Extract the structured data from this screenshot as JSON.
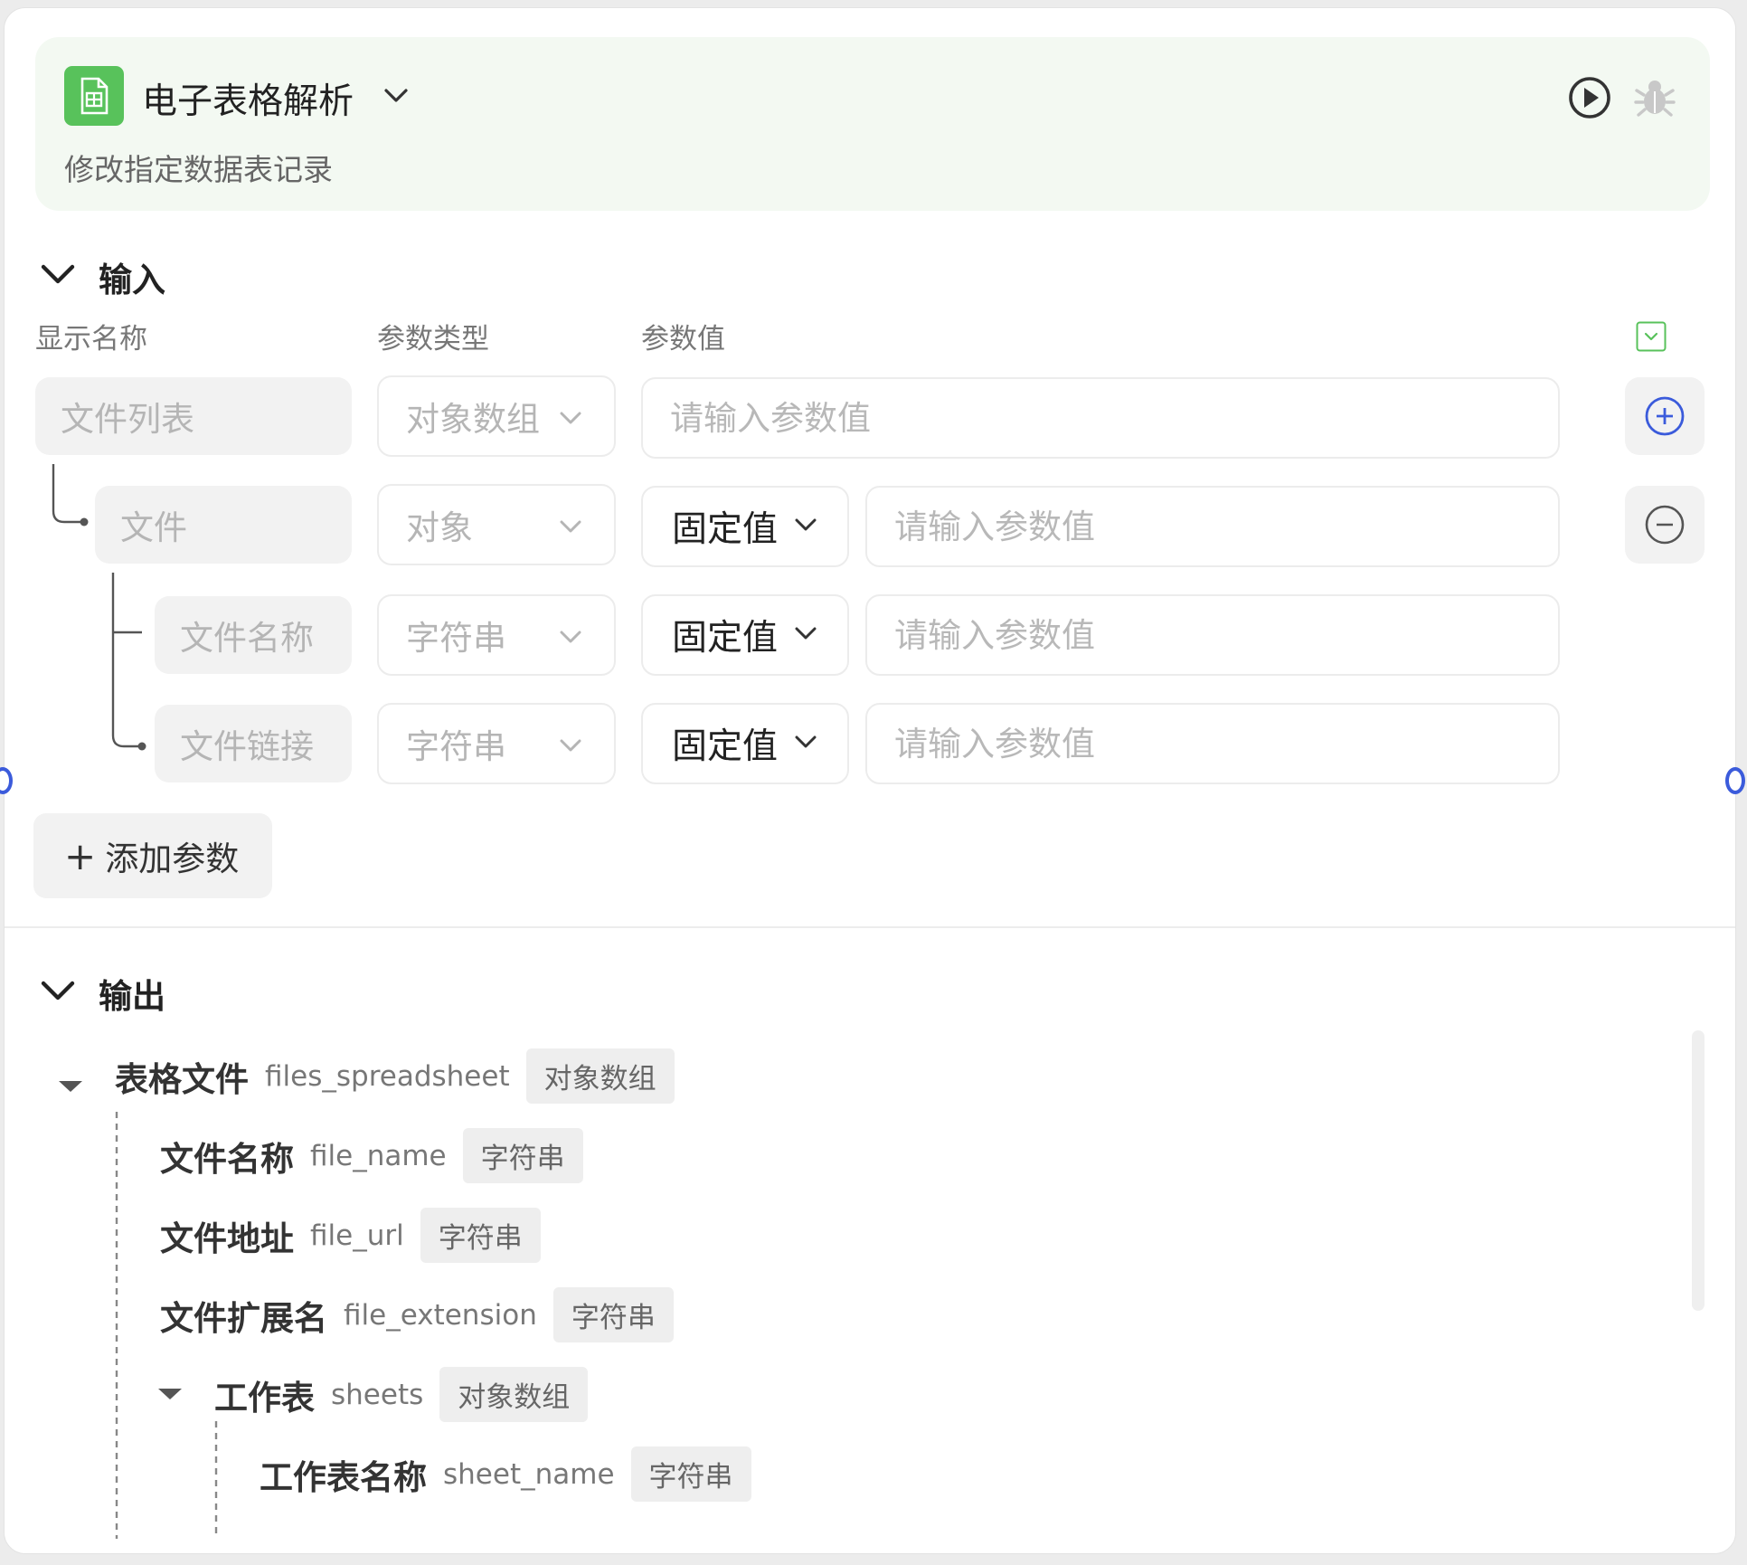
{
  "node": {
    "title": "电子表格解析",
    "description": "修改指定数据表记录"
  },
  "input_section": {
    "title": "输入",
    "columns": {
      "name": "显示名称",
      "type": "参数类型",
      "value": "参数值"
    },
    "rows": [
      {
        "name": "文件列表",
        "type": "对象数组",
        "value_placeholder": "请输入参数值"
      },
      {
        "name": "文件",
        "type": "对象",
        "mode": "固定值",
        "value_placeholder": "请输入参数值"
      },
      {
        "name": "文件名称",
        "type": "字符串",
        "mode": "固定值",
        "value_placeholder": "请输入参数值"
      },
      {
        "name": "文件链接",
        "type": "字符串",
        "mode": "固定值",
        "value_placeholder": "请输入参数值"
      }
    ],
    "add_button": "添加参数"
  },
  "output_section": {
    "title": "输出",
    "items": [
      {
        "name": "表格文件",
        "key": "files_spreadsheet",
        "type": "对象数组"
      },
      {
        "name": "文件名称",
        "key": "file_name",
        "type": "字符串"
      },
      {
        "name": "文件地址",
        "key": "file_url",
        "type": "字符串"
      },
      {
        "name": "文件扩展名",
        "key": "file_extension",
        "type": "字符串"
      },
      {
        "name": "工作表",
        "key": "sheets",
        "type": "对象数组"
      },
      {
        "name": "工作表名称",
        "key": "sheet_name",
        "type": "字符串"
      }
    ]
  },
  "colors": {
    "brand_green": "#58c25b",
    "header_bg": "#f3f9f2",
    "accent_blue": "#3b5bdb"
  }
}
